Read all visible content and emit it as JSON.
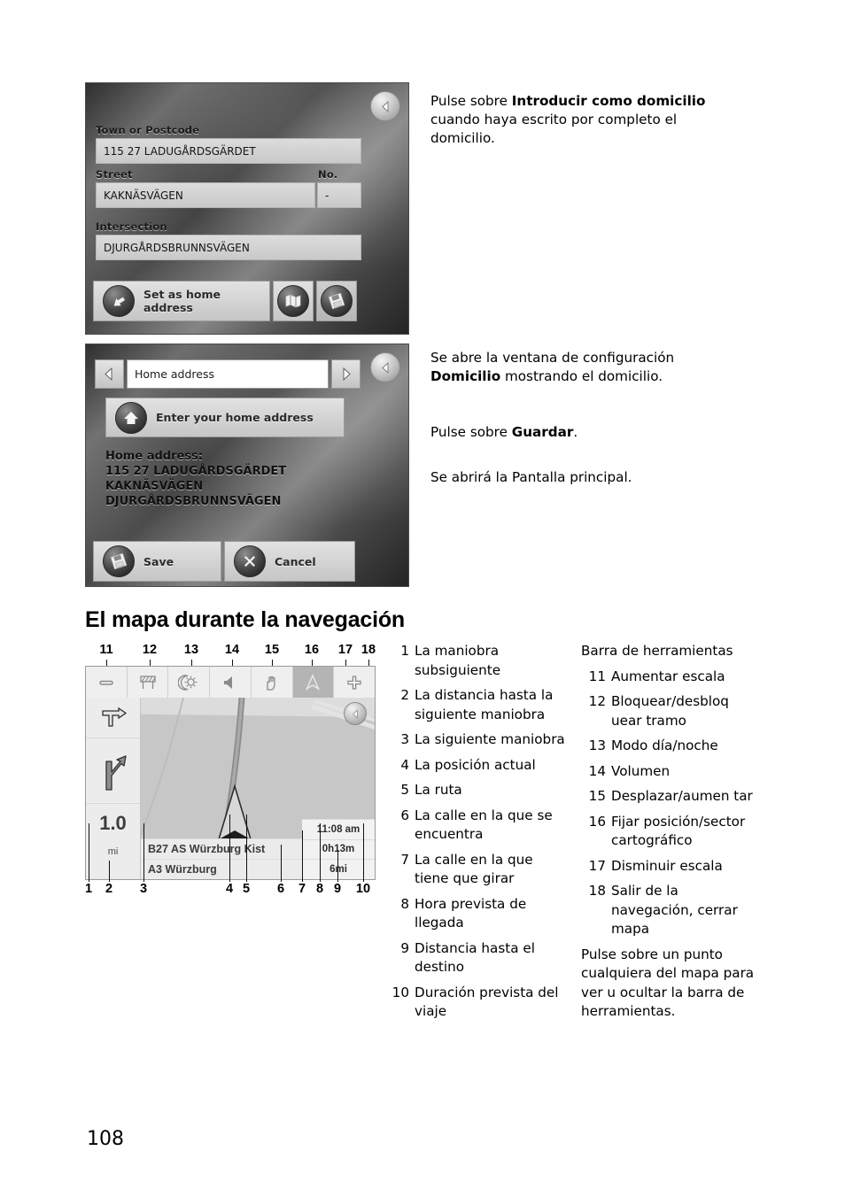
{
  "page": {
    "number": "108"
  },
  "screenshot_home_entry": {
    "back_icon": "back-arrow-icon",
    "fields": [
      {
        "label": "Town or Postcode",
        "value": "115 27 LADUGÅRDSGÄRDET"
      },
      {
        "label": "Street",
        "value": "KAKNÄSVÄGEN",
        "sub_label": "No.",
        "sub_value": "-"
      },
      {
        "label": "Intersection",
        "value": "DJURGÅRDSBRUNNSVÄGEN"
      }
    ],
    "buttons": [
      {
        "label": "Set as home address",
        "icon": "home-arrow-icon"
      },
      {
        "label": "",
        "icon": "map-icon"
      },
      {
        "label": "",
        "icon": "save-disk-icon"
      }
    ]
  },
  "text_block_1": {
    "lead": "Pulse sobre ",
    "bold": "Introducir como domicilio",
    "tail": " cuando haya escrito por completo el domicilio."
  },
  "screenshot_home_settings": {
    "back_icon": "back-arrow-icon",
    "prev_icon": "chevron-left-icon",
    "next_icon": "chevron-right-icon",
    "title": "Home address",
    "enter_button": {
      "label": "Enter your home address",
      "icon": "home-icon"
    },
    "address_heading": "Home address:",
    "address_lines": [
      "115 27 LADUGÅRDSGÄRDET",
      "KAKNÄSVÄGEN",
      "DJURGÅRDSBRUNNSVÄGEN"
    ],
    "buttons": [
      {
        "label": "Save",
        "icon": "save-disk-icon"
      },
      {
        "label": "Cancel",
        "icon": "cancel-x-icon"
      }
    ]
  },
  "text_block_2": {
    "p1_lead": "Se abre la ventana de configuración ",
    "p1_smallcaps": "Domicilio",
    "p1_tail": " mostrando el domicilio.",
    "p2_lead": "Pulse sobre ",
    "p2_bold": "Guardar",
    "p2_tail": ".",
    "p3": "Se abrirá la Pantalla principal."
  },
  "section": {
    "title": "El mapa durante la navegación"
  },
  "nav_screenshot": {
    "toolbar": [
      {
        "n": "11",
        "icon": "minus-icon",
        "selected": false
      },
      {
        "n": "12",
        "icon": "road-barrier-icon",
        "selected": false
      },
      {
        "n": "13",
        "icon": "sun-moon-icon",
        "selected": false
      },
      {
        "n": "14",
        "icon": "speaker-icon",
        "selected": false
      },
      {
        "n": "15",
        "icon": "hand-icon",
        "selected": false
      },
      {
        "n": "16",
        "icon": "compass-arrow-icon",
        "selected": true
      },
      {
        "n": "17",
        "icon": "plus-icon",
        "selected": false
      }
    ],
    "back_icon": "back-arrow-icon",
    "next_maneuver_icon": "turn-right-ahead-icon",
    "following_maneuver_icon": "merge-right-icon",
    "distance_value": "1.0",
    "distance_unit": "mi",
    "street_current": "B27 AS Würzburg Kist",
    "street_next": "A3 Würzburg",
    "arrival_time": "11:08 am",
    "trip_duration": "0h13m",
    "distance_remaining": "6mi",
    "top_callouts": [
      "11",
      "12",
      "13",
      "14",
      "15",
      "16",
      "17",
      "18"
    ],
    "bottom_callouts": [
      "1",
      "2",
      "3",
      "4",
      "5",
      "6",
      "7",
      "8",
      "9",
      "10"
    ]
  },
  "legend_left": [
    {
      "n": "1",
      "text": "La maniobra subsiguiente"
    },
    {
      "n": "2",
      "text": "La distancia hasta la siguiente maniobra"
    },
    {
      "n": "3",
      "text": "La siguiente maniobra"
    },
    {
      "n": "4",
      "text": "La posición actual"
    },
    {
      "n": "5",
      "text": "La ruta"
    },
    {
      "n": "6",
      "text": "La calle en la que se encuentra"
    },
    {
      "n": "7",
      "text": "La calle en la que tiene que girar"
    },
    {
      "n": "8",
      "text": "Hora prevista de llegada"
    },
    {
      "n": "9",
      "text": "Distancia hasta el destino"
    },
    {
      "n": "10",
      "text": "Duración prevista del viaje"
    }
  ],
  "legend_right": {
    "heading": "Barra de herramientas",
    "items": [
      {
        "n": "11",
        "text": "Aumentar escala"
      },
      {
        "n": "12",
        "text": "Bloquear/desbloq uear tramo"
      },
      {
        "n": "13",
        "text": "Modo día/noche"
      },
      {
        "n": "14",
        "text": "Volumen"
      },
      {
        "n": "15",
        "text": "Desplazar/aumen tar"
      },
      {
        "n": "16",
        "text": "Fijar posición/sector cartográfico"
      },
      {
        "n": "17",
        "text": "Disminuir escala"
      },
      {
        "n": "18",
        "text": "Salir de la navegación, cerrar mapa"
      }
    ],
    "footnote": "Pulse sobre un punto cualquiera del mapa para ver u ocultar la barra de herramientas."
  }
}
